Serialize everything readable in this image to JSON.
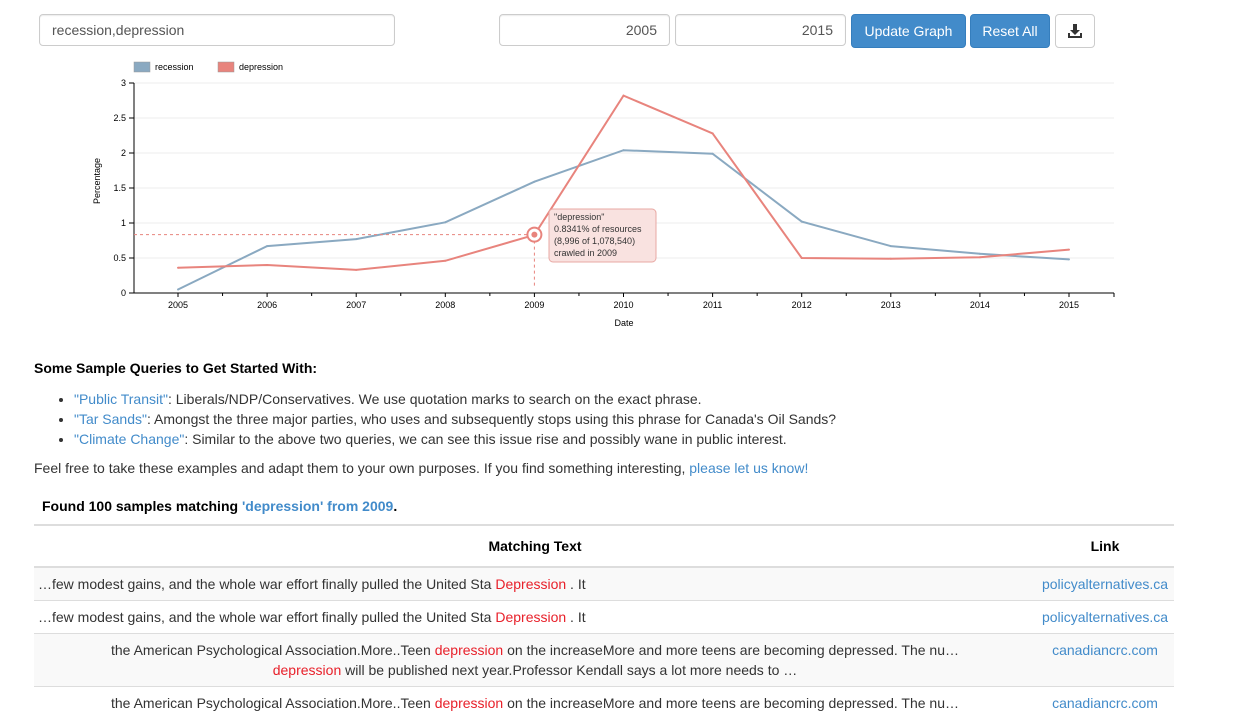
{
  "controls": {
    "query_value": "recession,depression",
    "start_year": "2005",
    "end_year": "2015",
    "update_label": "Update Graph",
    "reset_label": "Reset All",
    "download_icon": "download-icon"
  },
  "chart_data": {
    "type": "line",
    "x": [
      2005,
      2006,
      2007,
      2008,
      2009,
      2010,
      2011,
      2012,
      2013,
      2014,
      2015
    ],
    "xlabel": "Date",
    "ylabel": "Percentage",
    "ylim": [
      0,
      3
    ],
    "yticks": [
      "0",
      "0.5",
      "1",
      "1.5",
      "2",
      "2.5",
      "3"
    ],
    "grid": true,
    "legend": "top-left",
    "series": [
      {
        "name": "recession",
        "color": "#8aa9c1",
        "values": [
          0.05,
          0.67,
          0.77,
          1.01,
          1.59,
          2.04,
          1.99,
          1.02,
          0.67,
          0.56,
          0.48
        ]
      },
      {
        "name": "depression",
        "color": "#e8847d",
        "values": [
          0.36,
          0.4,
          0.33,
          0.46,
          0.83,
          2.82,
          2.28,
          0.5,
          0.49,
          0.51,
          0.62
        ]
      }
    ],
    "tooltip": {
      "series": "\"depression\"",
      "line1": "0.8341% of resources",
      "line2": "(8,996 of 1,078,540)",
      "line3": "crawled in 2009",
      "x": 2009,
      "y": 0.8341
    }
  },
  "samples": {
    "title": "Some Sample Queries to Get Started With:",
    "items": [
      {
        "query": "\"Public Transit\"",
        "desc": ": Liberals/NDP/Conservatives. We use quotation marks to search on the exact phrase."
      },
      {
        "query": "\"Tar Sands\"",
        "desc": ": Amongst the three major parties, who uses and subsequently stops using this phrase for Canada's Oil Sands?"
      },
      {
        "query": "\"Climate Change\"",
        "desc": ": Similar to the above two queries, we can see this issue rise and possibly wane in public interest."
      }
    ],
    "para_text": "Feel free to take these examples and adapt them to your own purposes. If you find something interesting, ",
    "para_link": "please let us know!"
  },
  "results": {
    "found_prefix": "Found 100 samples matching ",
    "found_highlight": "'depression' from 2009",
    "found_suffix": ".",
    "col_text": "Matching Text",
    "col_link": "Link",
    "rows": [
      {
        "before": "…few modest gains, and the whole war effort finally pulled the United Sta ",
        "kw": "Depression",
        "after": " . It",
        "line2_kw": "",
        "line2_after": "",
        "link": "policyalternatives.ca"
      },
      {
        "before": "…few modest gains, and the whole war effort finally pulled the United Sta ",
        "kw": "Depression",
        "after": " . It",
        "line2_kw": "",
        "line2_after": "",
        "link": "policyalternatives.ca"
      },
      {
        "before": "the American Psychological Association.More..Teen ",
        "kw": "depression",
        "after": " on the increaseMore and more teens are becoming depressed. The nu…",
        "line2_kw": "depression",
        "line2_after": " will be published next year.Professor Kendall says a lot more needs to …",
        "link": "canadiancrc.com"
      },
      {
        "before": "the American Psychological Association.More..Teen ",
        "kw": "depression",
        "after": " on the increaseMore and more teens are becoming depressed. The nu…",
        "line2_kw": "",
        "line2_after": "",
        "link": "canadiancrc.com"
      }
    ]
  }
}
